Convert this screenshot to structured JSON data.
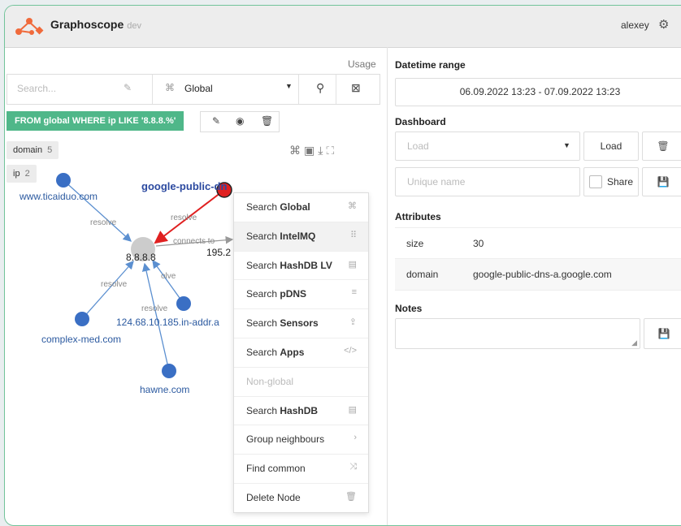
{
  "app": {
    "name": "Graphoscope",
    "env": "dev",
    "user": "alexey"
  },
  "left": {
    "usage_label": "Usage",
    "search": {
      "placeholder": "Search...",
      "value": ""
    },
    "scope": "Global",
    "query": "FROM global WHERE ip LIKE '8.8.8.%'",
    "tags": [
      {
        "label": "domain",
        "count": "5"
      },
      {
        "label": "ip",
        "count": "2"
      }
    ]
  },
  "graph": {
    "nodes": {
      "n1": "www.ticaiduo.com",
      "n2": "google-public-dn",
      "n3": "8.8.8.8",
      "n4": "195.2",
      "n5": "124.68.10.185.in-addr.a",
      "n6": "complex-med.com",
      "n7": "hawne.com"
    },
    "edges": {
      "e1": "resolve",
      "e2": "resolve",
      "e3": "connects to",
      "e4": "resolve",
      "e5": "resolve",
      "e6": "olve"
    }
  },
  "context_menu": {
    "items": [
      {
        "prefix": "Search",
        "bold": "Global",
        "icon": "⌘"
      },
      {
        "prefix": "Search",
        "bold": "IntelMQ",
        "icon": "⠿"
      },
      {
        "prefix": "Search",
        "bold": "HashDB LV",
        "icon": "▤"
      },
      {
        "prefix": "Search",
        "bold": "pDNS",
        "icon": "≡"
      },
      {
        "prefix": "Search",
        "bold": "Sensors",
        "icon": "⇪"
      },
      {
        "prefix": "Search",
        "bold": "Apps",
        "icon": "</>"
      },
      {
        "prefix": "Non-global",
        "bold": "",
        "icon": ""
      },
      {
        "prefix": "Search",
        "bold": "HashDB",
        "icon": "▤"
      },
      {
        "prefix": "Group neighbours",
        "bold": "",
        "icon": "›"
      },
      {
        "prefix": "Find common",
        "bold": "",
        "icon": "⤨"
      },
      {
        "prefix": "Delete Node",
        "bold": "",
        "icon": "🗑"
      }
    ]
  },
  "right": {
    "datetime": {
      "label": "Datetime range",
      "value": "06.09.2022 13:23  -  07.09.2022 13:23"
    },
    "dashboard": {
      "label": "Dashboard",
      "load_placeholder": "Load",
      "load_button": "Load",
      "name_placeholder": "Unique name",
      "share_label": "Share"
    },
    "attributes": {
      "label": "Attributes",
      "rows": [
        {
          "key": "size",
          "value": "30"
        },
        {
          "key": "domain",
          "value": "google-public-dns-a.google.com"
        }
      ]
    },
    "notes": {
      "label": "Notes",
      "value": ""
    }
  },
  "colors": {
    "accent": "#4fb789",
    "node": "#3a6fc4",
    "selected": "#e02020",
    "center": "#cccccc",
    "edge": "#5b8fd0"
  }
}
